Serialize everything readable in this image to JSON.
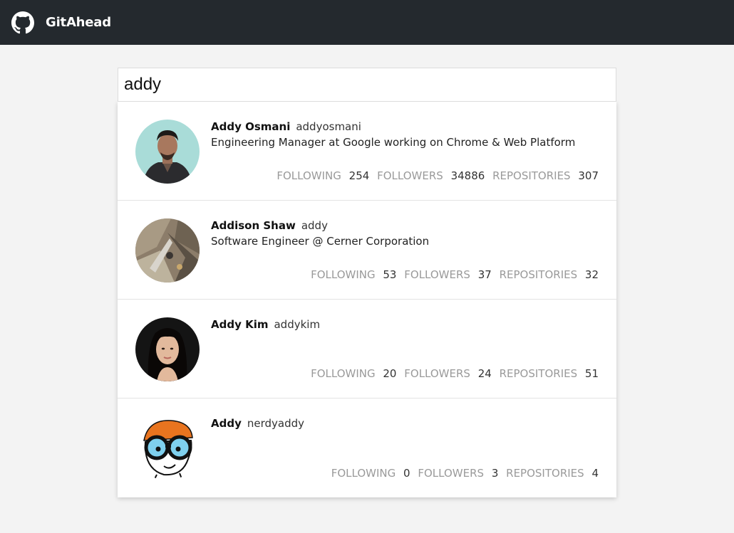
{
  "app": {
    "title": "GitAhead"
  },
  "search": {
    "value": "addy"
  },
  "stat_labels": {
    "following": "FOLLOWING",
    "followers": "FOLLOWERS",
    "repositories": "REPOSITORIES"
  },
  "results": [
    {
      "name": "Addy Osmani",
      "login": "addyosmani",
      "bio": "Engineering Manager at Google working on Chrome & Web Platform",
      "following": "254",
      "followers": "34886",
      "repositories": "307"
    },
    {
      "name": "Addison Shaw",
      "login": "addy",
      "bio": "Software Engineer @ Cerner Corporation",
      "following": "53",
      "followers": "37",
      "repositories": "32"
    },
    {
      "name": "Addy Kim",
      "login": "addykim",
      "bio": "",
      "following": "20",
      "followers": "24",
      "repositories": "51"
    },
    {
      "name": "Addy",
      "login": "nerdyaddy",
      "bio": "",
      "following": "0",
      "followers": "3",
      "repositories": "4"
    }
  ]
}
